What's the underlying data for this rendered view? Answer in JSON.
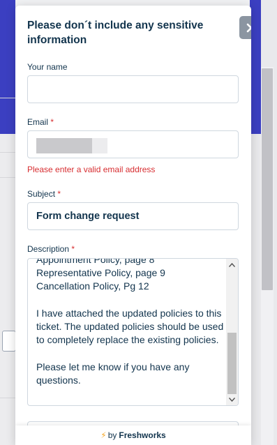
{
  "widget": {
    "title": "Please don´t include any sensitive information",
    "close_icon": "close-icon",
    "fields": {
      "name": {
        "label": "Your name",
        "value": ""
      },
      "email": {
        "label": "Email",
        "required_mark": "*",
        "value": "",
        "error": "Please enter a valid email address"
      },
      "subject": {
        "label": "Subject",
        "required_mark": "*",
        "value": "Form change request"
      },
      "description": {
        "label": "Description",
        "required_mark": "*",
        "value": "Appointment Policy, page 8\nRepresentative Policy, page 9\nCancellation Policy, Pg 12\n\nI have attached the updated policies to this ticket. The updated policies should be used to completely replace the existing policies.\n\nPlease let me know if you have any questions."
      }
    },
    "footer": {
      "prefix": "by",
      "brand": "Freshworks",
      "icon": "lightning-bolt-icon"
    }
  },
  "colors": {
    "accent": "#3b3fc1",
    "text": "#12344d",
    "error": "#d72d30",
    "close_bg": "#8b95a1"
  }
}
